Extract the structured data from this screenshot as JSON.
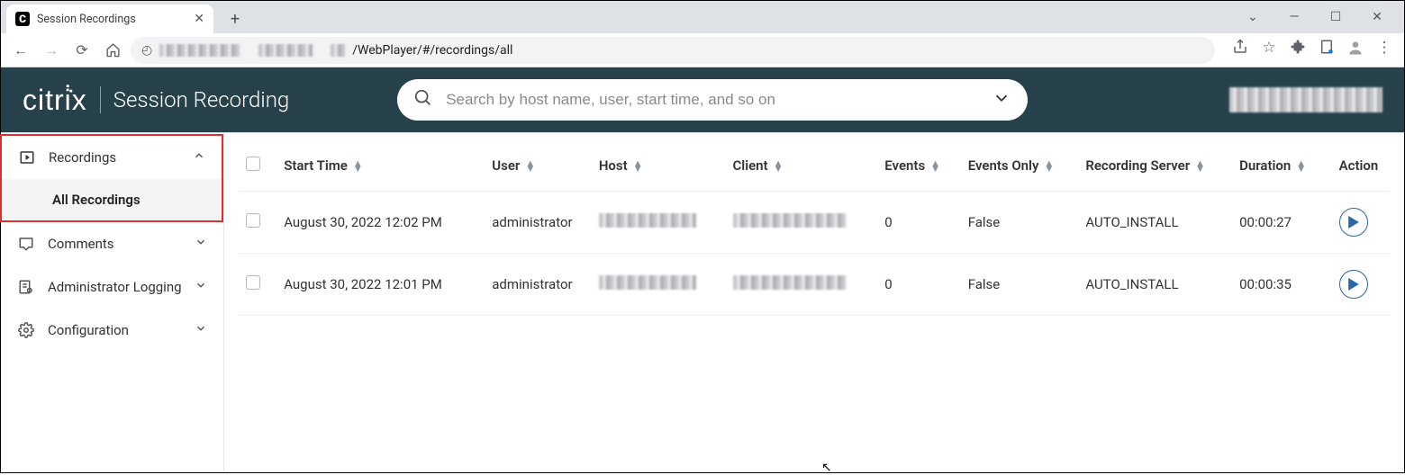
{
  "browser": {
    "tab_title": "Session Recordings",
    "url_visible": "/WebPlayer/#/recordings/all"
  },
  "header": {
    "brand": "citrix",
    "product": "Session Recording",
    "search_placeholder": "Search by host name, user, start time, and so on"
  },
  "sidebar": {
    "items": [
      {
        "label": "Recordings",
        "expanded": true,
        "sub": [
          {
            "label": "All Recordings",
            "active": true
          }
        ]
      },
      {
        "label": "Comments"
      },
      {
        "label": "Administrator Logging"
      },
      {
        "label": "Configuration"
      }
    ]
  },
  "table": {
    "columns": {
      "start_time": "Start Time",
      "user": "User",
      "host": "Host",
      "client": "Client",
      "events": "Events",
      "events_only": "Events Only",
      "recording_server": "Recording Server",
      "duration": "Duration",
      "action": "Action"
    },
    "rows": [
      {
        "start_time": "August 30, 2022 12:02 PM",
        "user": "administrator",
        "host": "",
        "client": "",
        "events": "0",
        "events_only": "False",
        "recording_server": "AUTO_INSTALL",
        "duration": "00:00:27"
      },
      {
        "start_time": "August 30, 2022 12:01 PM",
        "user": "administrator",
        "host": "",
        "client": "",
        "events": "0",
        "events_only": "False",
        "recording_server": "AUTO_INSTALL",
        "duration": "00:00:35"
      }
    ]
  }
}
